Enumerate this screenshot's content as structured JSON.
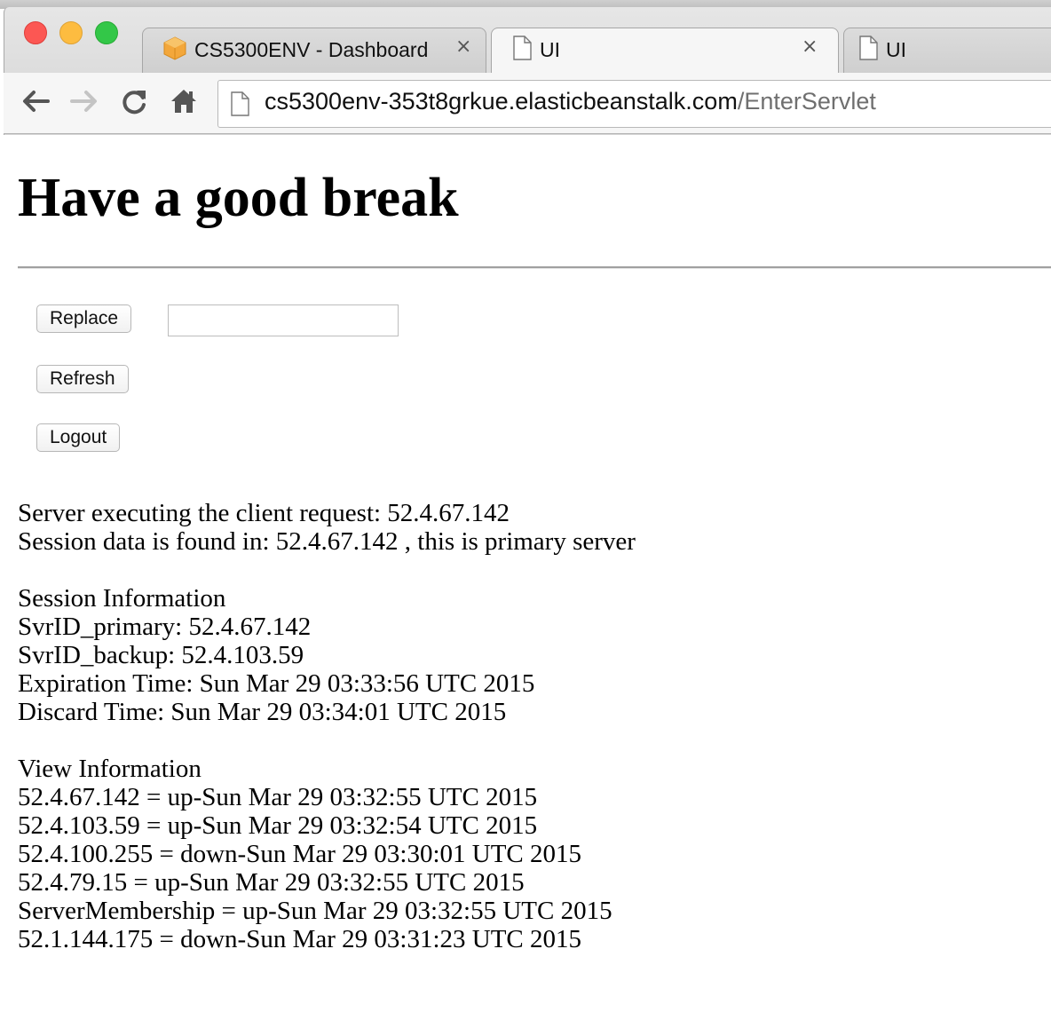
{
  "browser": {
    "tabs": [
      {
        "title": "CS5300ENV - Dashboard",
        "icon": "aws-box-icon",
        "active": false
      },
      {
        "title": "UI",
        "icon": "document-icon",
        "active": true
      },
      {
        "title": "UI",
        "icon": "document-icon",
        "active": false
      }
    ],
    "close_glyph": "×",
    "url": {
      "host": "cs5300env-353t8grkue.elasticbeanstalk.com",
      "path": "/EnterServlet"
    },
    "nav_icons": [
      "back-arrow-icon",
      "forward-arrow-icon",
      "reload-icon",
      "home-icon"
    ]
  },
  "page": {
    "heading": "Have a good break",
    "buttons": {
      "replace": "Replace",
      "refresh": "Refresh",
      "logout": "Logout"
    },
    "replace_input": {
      "value": "",
      "placeholder": ""
    },
    "server_lines": [
      "Server executing the client request: 52.4.67.142",
      "Session data is found in: 52.4.67.142 , this is primary server"
    ],
    "session_section": {
      "title": "Session Information",
      "lines": [
        "SvrID_primary: 52.4.67.142",
        "SvrID_backup: 52.4.103.59",
        "Expiration Time: Sun Mar 29 03:33:56 UTC 2015",
        "Discard Time: Sun Mar 29 03:34:01 UTC 2015"
      ]
    },
    "view_section": {
      "title": "View Information",
      "lines": [
        "52.4.67.142 = up-Sun Mar 29 03:32:55 UTC 2015",
        "52.4.103.59 = up-Sun Mar 29 03:32:54 UTC 2015",
        "52.4.100.255 = down-Sun Mar 29 03:30:01 UTC 2015",
        "52.4.79.15 = up-Sun Mar 29 03:32:55 UTC 2015",
        "ServerMembership = up-Sun Mar 29 03:32:55 UTC 2015",
        "52.1.144.175 = down-Sun Mar 29 03:31:23 UTC 2015"
      ]
    }
  }
}
